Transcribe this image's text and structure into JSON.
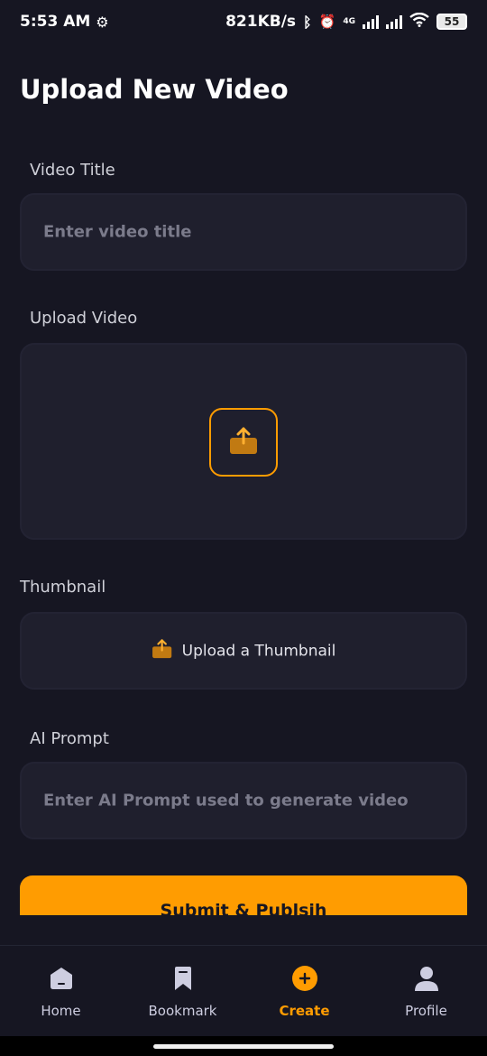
{
  "status_bar": {
    "time": "5:53 AM",
    "net_speed": "821KB/s",
    "network_type": "4G",
    "battery": "55"
  },
  "page": {
    "title": "Upload New Video"
  },
  "form": {
    "video_title": {
      "label": "Video Title",
      "placeholder": "Enter video title"
    },
    "upload_video": {
      "label": "Upload Video",
      "icon": "upload-icon"
    },
    "thumbnail": {
      "label": "Thumbnail",
      "button_text": "Upload a Thumbnail",
      "icon": "upload-icon"
    },
    "ai_prompt": {
      "label": "AI Prompt",
      "placeholder": "Enter AI Prompt used to generate video"
    },
    "submit_label": "Submit & Publsih"
  },
  "nav": {
    "items": [
      {
        "label": "Home",
        "icon": "home-icon",
        "active": false
      },
      {
        "label": "Bookmark",
        "icon": "bookmark-icon",
        "active": false
      },
      {
        "label": "Create",
        "icon": "plus-circle-icon",
        "active": true
      },
      {
        "label": "Profile",
        "icon": "profile-icon",
        "active": false
      }
    ]
  },
  "colors": {
    "background": "#161622",
    "field": "#1f1f2d",
    "accent": "#ff9c01",
    "upload_icon": "#c17a12"
  }
}
